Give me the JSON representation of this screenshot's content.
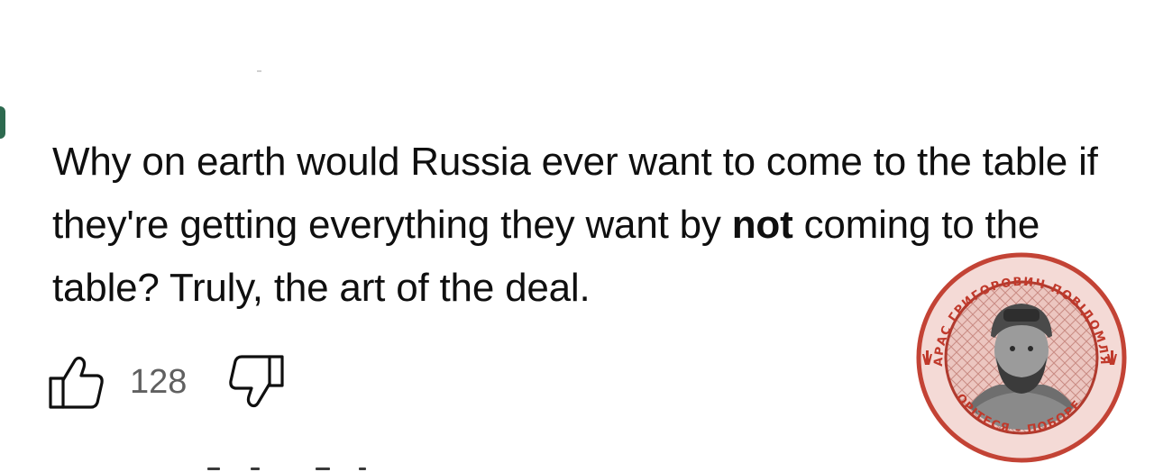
{
  "comment": {
    "text_part1": "Why on earth would Russia ever want to come to the table if they're getting everything they want by ",
    "text_bold": "not",
    "text_part2": " coming to the table? Truly, the art of the deal."
  },
  "actions": {
    "like_icon": "thumbs-up-icon",
    "like_count": "128",
    "dislike_icon": "thumbs-down-icon"
  },
  "watermark": {
    "text_top": "ТАРАС ГРИГОРОВИЧ ПОВІДОМЛЯЄ",
    "text_bottom": "БОРІТЕСЯ – ПОБОРЕТЕ",
    "color": "#c0392b"
  },
  "colors": {
    "text": "#0f0f0f",
    "secondary_text": "#606060",
    "background": "#ffffff"
  }
}
